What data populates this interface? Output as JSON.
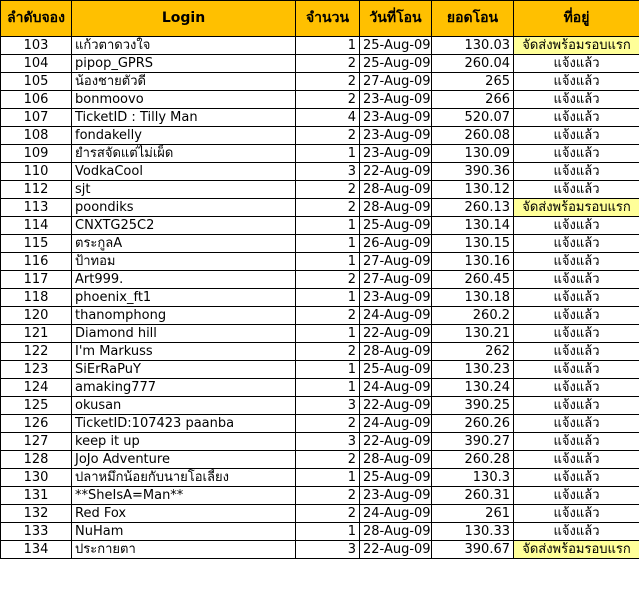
{
  "headers": [
    "ลำดับจอง",
    "Login",
    "จำนวน",
    "วันที่โอน",
    "ยอดโอน",
    "ที่อยู่"
  ],
  "colors": {
    "header_bg": "#ffc000",
    "highlight_bg": "#ffff99"
  },
  "rows": [
    {
      "no": "103",
      "login": "แก้วตาดวงใจ",
      "qty": "1",
      "date": "25-Aug-09",
      "amount": "130.03",
      "status": "จัดส่งพร้อมรอบแรก",
      "highlight": true
    },
    {
      "no": "104",
      "login": "pipop_GPRS",
      "qty": "2",
      "date": "25-Aug-09",
      "amount": "260.04",
      "status": "แจ้งแล้ว",
      "highlight": false
    },
    {
      "no": "105",
      "login": "น้องชายตัวดี",
      "qty": "2",
      "date": "27-Aug-09",
      "amount": "265",
      "status": "แจ้งแล้ว",
      "highlight": false
    },
    {
      "no": "106",
      "login": "bonmoovo",
      "qty": "2",
      "date": "23-Aug-09",
      "amount": "266",
      "status": "แจ้งแล้ว",
      "highlight": false
    },
    {
      "no": "107",
      "login": "TicketID : Tilly Man",
      "qty": "4",
      "date": "23-Aug-09",
      "amount": "520.07",
      "status": "แจ้งแล้ว",
      "highlight": false
    },
    {
      "no": "108",
      "login": "fondakelly",
      "qty": "2",
      "date": "23-Aug-09",
      "amount": "260.08",
      "status": "แจ้งแล้ว",
      "highlight": false
    },
    {
      "no": "109",
      "login": "ยำรสจัดแต่ไม่เผ็ด",
      "qty": "1",
      "date": "23-Aug-09",
      "amount": "130.09",
      "status": "แจ้งแล้ว",
      "highlight": false
    },
    {
      "no": "110",
      "login": "VodkaCool",
      "qty": "3",
      "date": "22-Aug-09",
      "amount": "390.36",
      "status": "แจ้งแล้ว",
      "highlight": false
    },
    {
      "no": "112",
      "login": "sjt",
      "qty": "2",
      "date": "28-Aug-09",
      "amount": "130.12",
      "status": "แจ้งแล้ว",
      "highlight": false
    },
    {
      "no": "113",
      "login": "poondiks",
      "qty": "2",
      "date": "28-Aug-09",
      "amount": "260.13",
      "status": "จัดส่งพร้อมรอบแรก",
      "highlight": true
    },
    {
      "no": "114",
      "login": "CNXTG25C2",
      "qty": "1",
      "date": "25-Aug-09",
      "amount": "130.14",
      "status": "แจ้งแล้ว",
      "highlight": false
    },
    {
      "no": "115",
      "login": "ตระกูลA",
      "qty": "1",
      "date": "26-Aug-09",
      "amount": "130.15",
      "status": "แจ้งแล้ว",
      "highlight": false
    },
    {
      "no": "116",
      "login": "ป้าทอม",
      "qty": "1",
      "date": "27-Aug-09",
      "amount": "130.16",
      "status": "แจ้งแล้ว",
      "highlight": false
    },
    {
      "no": "117",
      "login": "Art999.",
      "qty": "2",
      "date": "27-Aug-09",
      "amount": "260.45",
      "status": "แจ้งแล้ว",
      "highlight": false
    },
    {
      "no": "118",
      "login": "phoenix_ft1",
      "qty": "1",
      "date": "23-Aug-09",
      "amount": "130.18",
      "status": "แจ้งแล้ว",
      "highlight": false
    },
    {
      "no": "120",
      "login": "thanomphong",
      "qty": "2",
      "date": "24-Aug-09",
      "amount": "260.2",
      "status": "แจ้งแล้ว",
      "highlight": false
    },
    {
      "no": "121",
      "login": "Diamond hill",
      "qty": "1",
      "date": "22-Aug-09",
      "amount": "130.21",
      "status": "แจ้งแล้ว",
      "highlight": false
    },
    {
      "no": "122",
      "login": "I'm Markuss",
      "qty": "2",
      "date": "28-Aug-09",
      "amount": "262",
      "status": "แจ้งแล้ว",
      "highlight": false
    },
    {
      "no": "123",
      "login": "SiErRaPuY",
      "qty": "1",
      "date": "25-Aug-09",
      "amount": "130.23",
      "status": "แจ้งแล้ว",
      "highlight": false
    },
    {
      "no": "124",
      "login": "amaking777",
      "qty": "1",
      "date": "24-Aug-09",
      "amount": "130.24",
      "status": "แจ้งแล้ว",
      "highlight": false
    },
    {
      "no": "125",
      "login": "okusan",
      "qty": "3",
      "date": "22-Aug-09",
      "amount": "390.25",
      "status": "แจ้งแล้ว",
      "highlight": false
    },
    {
      "no": "126",
      "login": "TicketID:107423 paanba",
      "qty": "2",
      "date": "24-Aug-09",
      "amount": "260.26",
      "status": "แจ้งแล้ว",
      "highlight": false
    },
    {
      "no": "127",
      "login": "keep it up",
      "qty": "3",
      "date": "22-Aug-09",
      "amount": "390.27",
      "status": "แจ้งแล้ว",
      "highlight": false
    },
    {
      "no": "128",
      "login": "JoJo Adventure",
      "qty": "2",
      "date": "28-Aug-09",
      "amount": "260.28",
      "status": "แจ้งแล้ว",
      "highlight": false
    },
    {
      "no": "130",
      "login": "ปลาหมึกน้อยกับนายโอเลี้ยง",
      "qty": "1",
      "date": "25-Aug-09",
      "amount": "130.3",
      "status": "แจ้งแล้ว",
      "highlight": false
    },
    {
      "no": "131",
      "login": "**SheIsA=Man**",
      "qty": "2",
      "date": "23-Aug-09",
      "amount": "260.31",
      "status": "แจ้งแล้ว",
      "highlight": false
    },
    {
      "no": "132",
      "login": "Red Fox",
      "qty": "2",
      "date": "24-Aug-09",
      "amount": "261",
      "status": "แจ้งแล้ว",
      "highlight": false
    },
    {
      "no": "133",
      "login": "NuHam",
      "qty": "1",
      "date": "28-Aug-09",
      "amount": "130.33",
      "status": "แจ้งแล้ว",
      "highlight": false
    },
    {
      "no": "134",
      "login": "ประกายตา",
      "qty": "3",
      "date": "22-Aug-09",
      "amount": "390.67",
      "status": "จัดส่งพร้อมรอบแรก",
      "highlight": true
    }
  ]
}
